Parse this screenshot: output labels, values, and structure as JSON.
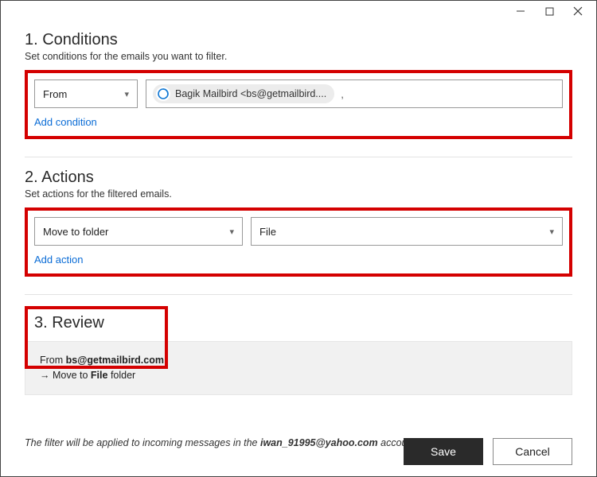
{
  "window": {
    "minimize_icon": "–"
  },
  "conditions": {
    "title": "1. Conditions",
    "subtitle": "Set conditions for the emails you want to filter.",
    "field_label": "From",
    "chip_text": "Bagik Mailbird  <bs@getmailbird....",
    "separator": ",",
    "add_link": "Add condition"
  },
  "actions": {
    "title": "2. Actions",
    "subtitle": "Set actions for the filtered emails.",
    "action_label": "Move to folder",
    "target_label": "File",
    "add_link": "Add action"
  },
  "review": {
    "title": "3. Review",
    "line1_prefix": "From ",
    "line1_bold": "bs@getmailbird.com",
    "line2_prefix": "→  Move to ",
    "line2_bold": "File",
    "line2_suffix": " folder"
  },
  "footer": {
    "text_prefix": "The filter will be applied to incoming messages in the ",
    "account": "iwan_91995@yahoo.com",
    "text_suffix": " account."
  },
  "buttons": {
    "save": "Save",
    "cancel": "Cancel"
  }
}
